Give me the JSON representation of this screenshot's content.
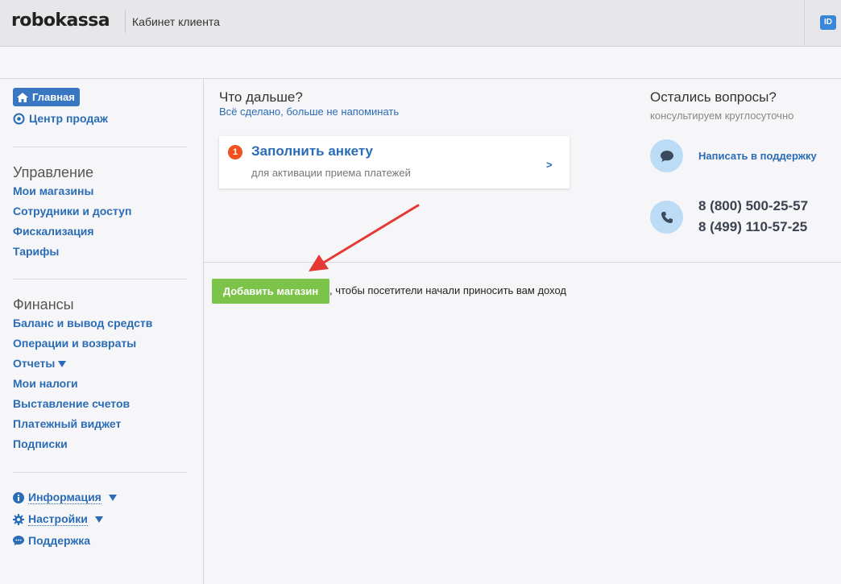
{
  "header": {
    "logo": "robokassa",
    "title": "Кабинет клиента",
    "id_badge": "ID"
  },
  "sidebar": {
    "home": "Главная",
    "sales_center": "Центр продаж",
    "management": {
      "title": "Управление",
      "items": [
        "Мои магазины",
        "Сотрудники и доступ",
        "Фискализация",
        "Тарифы"
      ]
    },
    "finance": {
      "title": "Финансы",
      "items": [
        "Баланс и вывод средств",
        "Операции и возвраты",
        "Отчеты",
        "Мои налоги",
        "Выставление счетов",
        "Платежный виджет",
        "Подписки"
      ]
    },
    "bottom": {
      "info": "Информация",
      "settings": "Настройки",
      "support": "Поддержка"
    }
  },
  "whats_next": {
    "title": "Что дальше?",
    "dismiss_link": "Всё сделано, больше не напоминать",
    "card": {
      "number": "1",
      "title": "Заполнить анкету",
      "subtitle": "для активации приема платежей",
      "arrow": ">"
    }
  },
  "questions": {
    "title": "Остались вопросы?",
    "subtitle": "консультируем круглосуточно",
    "support_link": "Написать в поддержку",
    "phones": [
      "8 (800) 500-25-57",
      "8 (499) 110-57-25"
    ]
  },
  "add_store": {
    "button": "Добавить магазин",
    "text": ", чтобы посетители начали приносить вам доход"
  },
  "colors": {
    "accent": "#2b6cb6",
    "button_green": "#7cc34a",
    "badge_orange": "#f0521e",
    "arrow_red": "#e53935"
  }
}
